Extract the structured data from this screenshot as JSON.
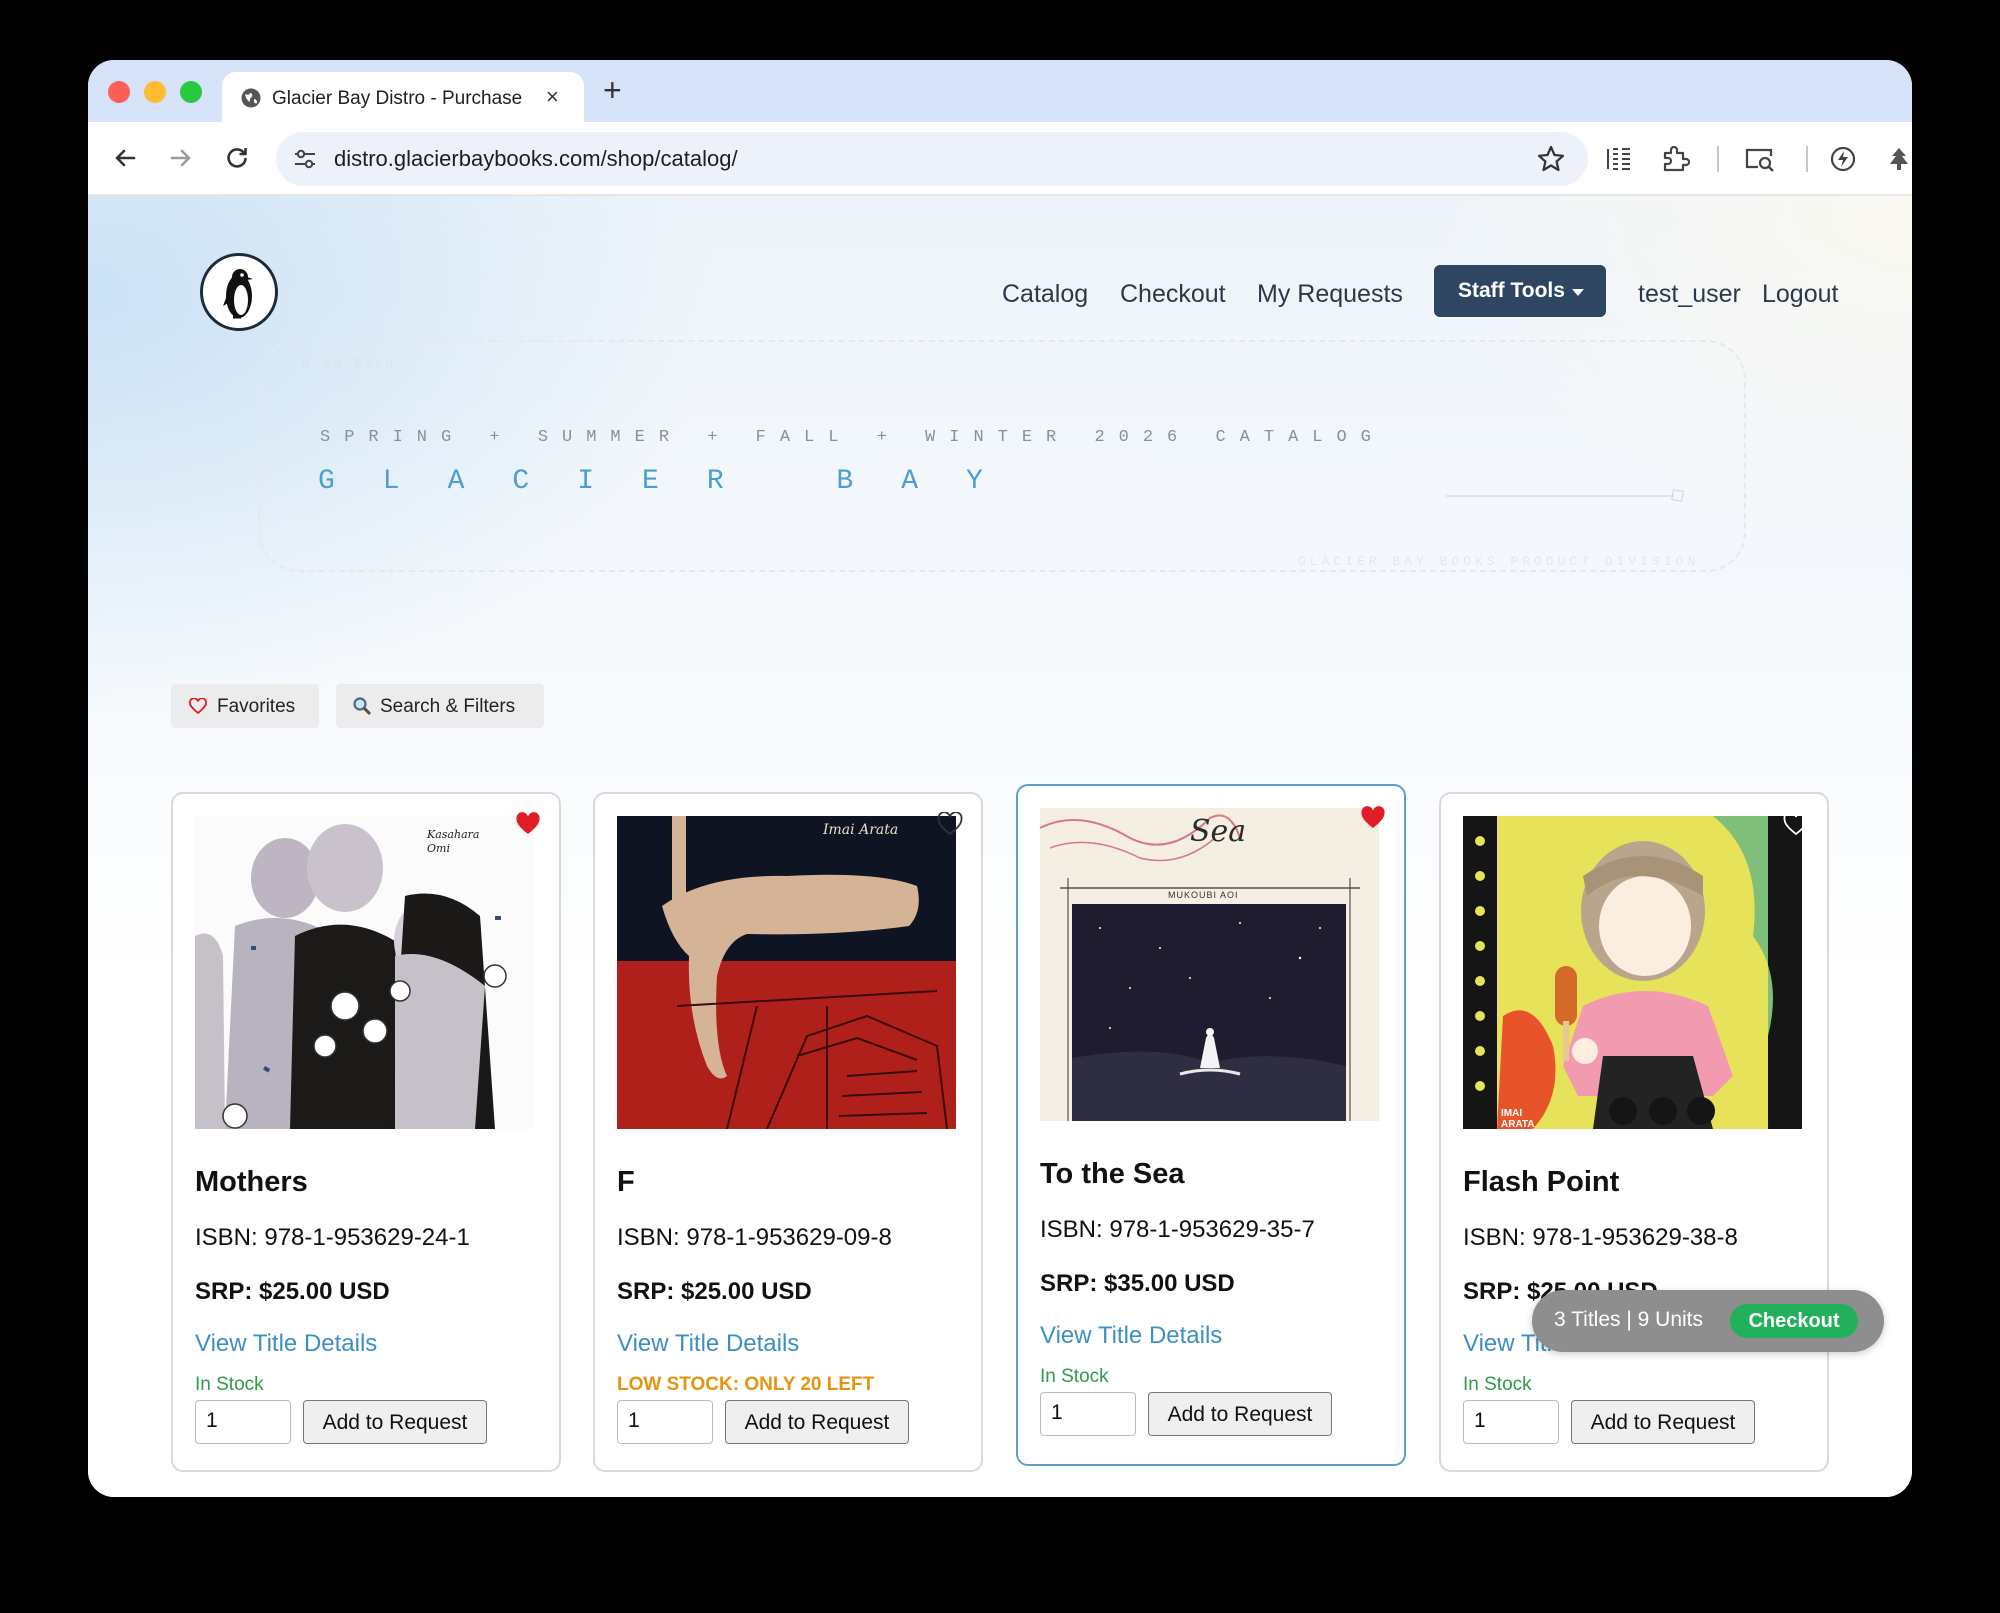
{
  "browser": {
    "tab_title": "Glacier Bay Distro - Purchase",
    "tab_close": "×",
    "new_tab": "+",
    "url": "distro.glacierbaybooks.com/shop/catalog/"
  },
  "nav": {
    "catalog": "Catalog",
    "checkout": "Checkout",
    "my_requests": "My Requests",
    "staff_tools": "Staff Tools",
    "user": "test_user",
    "logout": "Logout"
  },
  "banner": {
    "version": "0.00.βeta",
    "season": "SPRING + SUMMER + FALL + WINTER 2026 CATALOG",
    "wordmark": "GLACIER BAY",
    "division": "GLACIER BAY BOOKS PRODUCT DIVISION"
  },
  "filters": {
    "favorites": "Favorites",
    "search": "Search & Filters"
  },
  "colors": {
    "accent_dark": "#2f4663",
    "link": "#3c8fc4",
    "in_stock": "#2e9a4a",
    "low_stock": "#e59410",
    "favorite": "#e01e26",
    "checkout": "#22b15a"
  },
  "books": [
    {
      "title": "Mothers",
      "isbn": "ISBN: 978-1-953629-24-1",
      "srp": "SRP: $25.00 USD",
      "details_link": "View Title Details",
      "stock": "In Stock",
      "stock_level": "in",
      "quantity": "1",
      "add_label": "Add to Request",
      "favorited": true,
      "cover_text": "Kasahara Omi"
    },
    {
      "title": "F",
      "isbn": "ISBN: 978-1-953629-09-8",
      "srp": "SRP: $25.00 USD",
      "details_link": "View Title Details",
      "stock": "LOW STOCK: ONLY 20 LEFT",
      "stock_level": "low",
      "quantity": "1",
      "add_label": "Add to Request",
      "favorited": false,
      "cover_text": "Imai Arata"
    },
    {
      "title": "To the Sea",
      "isbn": "ISBN: 978-1-953629-35-7",
      "srp": "SRP: $35.00 USD",
      "details_link": "View Title Details",
      "stock": "In Stock",
      "stock_level": "in",
      "quantity": "1",
      "add_label": "Add to Request",
      "favorited": true,
      "cover_text": "Sea",
      "cover_subtext": "MUKOUBI AOI"
    },
    {
      "title": "Flash Point",
      "isbn": "ISBN: 978-1-953629-38-8",
      "srp": "SRP: $25.00 USD",
      "details_link": "View Title Details",
      "stock": "In Stock",
      "stock_level": "in",
      "quantity": "1",
      "add_label": "Add to Request",
      "favorited": false,
      "cover_text": "IMAI ARATA"
    }
  ],
  "cart": {
    "summary": "3 Titles | 9 Units",
    "checkout": "Checkout"
  }
}
